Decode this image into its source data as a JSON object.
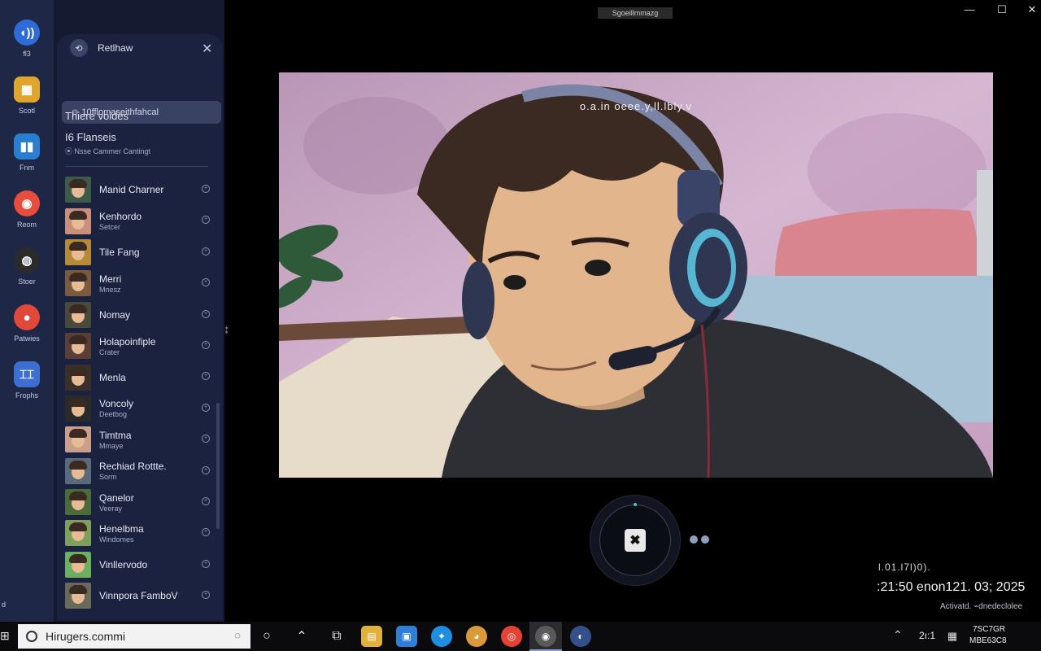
{
  "window": {
    "title": "Sgoeillmmazg"
  },
  "rail": {
    "items": [
      {
        "label": "fl3",
        "icon": "voice-icon",
        "glyph": "◖))",
        "color": "#2e6bd6"
      },
      {
        "label": "Scotl",
        "icon": "calendar-icon",
        "glyph": "▦",
        "color": "#e0a52c"
      },
      {
        "label": "Fnm",
        "icon": "book-icon",
        "glyph": "▮▮",
        "color": "#2a7ed0"
      },
      {
        "label": "Reom",
        "icon": "bag-icon",
        "glyph": "◉",
        "color": "#e74c3c"
      },
      {
        "label": "Stoer",
        "icon": "camera-icon",
        "glyph": "◍",
        "color": "#2b2b2b"
      },
      {
        "label": "Patwies",
        "icon": "record-icon",
        "glyph": "●",
        "color": "#e0483a"
      },
      {
        "label": "Frophs",
        "icon": "tools-icon",
        "glyph": "⌶⌶",
        "color": "#3d6fd1"
      }
    ],
    "bottom_label": "d"
  },
  "panel": {
    "title": "Retlhaw",
    "search_value": "10fflomaseithfahcal",
    "section_title": "Thiere voides",
    "sub_title": "I6 Flanseis",
    "sub_note": "Nsse Cammer Cantingt",
    "contacts": [
      {
        "name": "Manid Charner",
        "sub": "",
        "bg": "#3d5a4a"
      },
      {
        "name": "Kenhordo",
        "sub": "Setcer",
        "bg": "#c98f7c"
      },
      {
        "name": "Tile Fang",
        "sub": "",
        "bg": "#b58a3a"
      },
      {
        "name": "Merri",
        "sub": "Mnesz",
        "bg": "#7b5a3e"
      },
      {
        "name": "Nomay",
        "sub": "",
        "bg": "#4a4a3a"
      },
      {
        "name": "Holapoinfiple",
        "sub": "Crater",
        "bg": "#5a3f36"
      },
      {
        "name": "Menla",
        "sub": "",
        "bg": "#3a2f2a"
      },
      {
        "name": "Voncoly",
        "sub": "Deetbog",
        "bg": "#2a2a2a"
      },
      {
        "name": "Timtma",
        "sub": "Mmaye",
        "bg": "#caa08a"
      },
      {
        "name": "Rechiad Rottte.",
        "sub": "Sorm",
        "bg": "#5a6a7a"
      },
      {
        "name": "Qanelor",
        "sub": "Veeray",
        "bg": "#4a6b3a"
      },
      {
        "name": "Henelbma",
        "sub": "Windomes",
        "bg": "#7fa05a"
      },
      {
        "name": "Vinllervodo",
        "sub": "",
        "bg": "#6bb060"
      },
      {
        "name": "Vinnpora FamboV",
        "sub": "",
        "bg": "#6a6a5a"
      }
    ]
  },
  "video": {
    "caption": "o.a.in oeee.y,ll.lbly.v"
  },
  "clock": {
    "line1": "l.01.l7l)0).",
    "line2": ":21:50 enon121. 03; 2025",
    "activate": "Activatd. ⌁dnedeclolee"
  },
  "taskbar": {
    "search_value": "Hirugers.commi",
    "tray_text": "2ı:1",
    "date1": "7SC7GR",
    "date2": "MBE63C8"
  }
}
